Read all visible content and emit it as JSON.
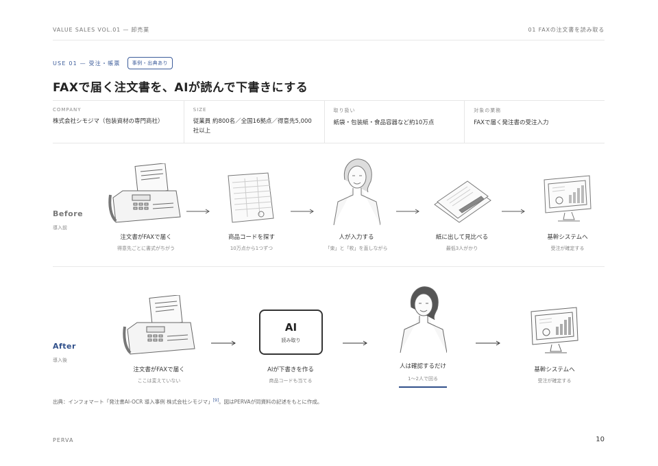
{
  "header": {
    "left": "VALUE SALES VOL.01 — 卸売業",
    "right": "01 FAXの注文書を読み取る"
  },
  "kicker": {
    "label": "USE 01 — 受注・帳票",
    "badge": "事例・出典あり"
  },
  "title": "FAXで届く注文書を、AIが読んで下書きにする",
  "meta": [
    {
      "label": "COMPANY",
      "value": "株式会社シモジマ（包装資材の専門商社）"
    },
    {
      "label": "SIZE",
      "value": "従業員 約800名／全国16拠点／得意先5,000社以上"
    },
    {
      "label": "取り扱い",
      "value": "紙袋・包装紙・食品容器など約10万点"
    },
    {
      "label": "対象の業務",
      "value": "FAXで届く発注書の受注入力"
    }
  ],
  "before": {
    "label": "Before",
    "sub": "導入前",
    "steps": [
      {
        "caption": "注文書がFAXで届く",
        "sub": "得意先ごとに書式がちがう",
        "icon": "fax-machine-icon"
      },
      {
        "caption": "商品コードを探す",
        "sub": "10万点から1つずつ",
        "icon": "price-list-icon"
      },
      {
        "caption": "人が入力する",
        "sub": "「束」と「枚」を直しながら",
        "icon": "person-icon"
      },
      {
        "caption": "紙に出して見比べる",
        "sub": "最低3人がかり",
        "icon": "papers-pen-icon"
      },
      {
        "caption": "基幹システムへ",
        "sub": "受注が確定する",
        "icon": "monitor-chart-icon"
      }
    ]
  },
  "after": {
    "label": "After",
    "sub": "導入後",
    "ai_box": {
      "title": "AI",
      "sub": "読み取り"
    },
    "steps": [
      {
        "caption": "注文書がFAXで届く",
        "sub": "ここは変えていない",
        "icon": "fax-machine-icon"
      },
      {
        "caption": "AIが下書きを作る",
        "sub": "商品コードも当てる",
        "icon": "ai-box-icon"
      },
      {
        "caption": "人は確認するだけ",
        "sub": "1〜2人で回る",
        "icon": "person-icon"
      },
      {
        "caption": "基幹システムへ",
        "sub": "受注が確定する",
        "icon": "monitor-chart-icon"
      }
    ]
  },
  "source": {
    "text": "出典：インフォマート「発注書AI-OCR 導入事例 株式会社シモジマ」",
    "ref": "[9]",
    "note": "。図はPERVAが同資料の記述をもとに作成。"
  },
  "footer": {
    "brand": "PERVA",
    "page": "10"
  }
}
